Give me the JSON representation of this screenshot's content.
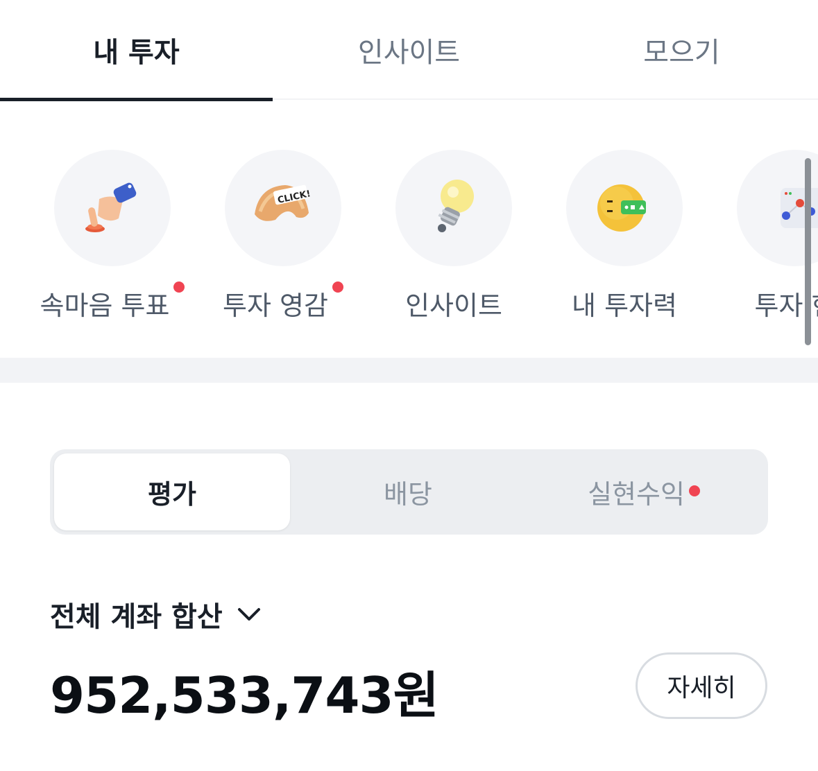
{
  "tabs": [
    {
      "label": "내 투자",
      "active": true
    },
    {
      "label": "인사이트",
      "active": false
    },
    {
      "label": "모으기",
      "active": false
    }
  ],
  "shortcuts": [
    {
      "label": "속마음 투표",
      "icon": "pointing-hand-button-icon",
      "new": true
    },
    {
      "label": "투자 영감",
      "icon": "fortune-cookie-click-icon",
      "badge_text": "CLICK!",
      "new": true
    },
    {
      "label": "인사이트",
      "icon": "lightbulb-icon",
      "new": false
    },
    {
      "label": "내 투자력",
      "icon": "smiley-face-icon",
      "new": false
    },
    {
      "label": "투자 현",
      "icon": "chart-board-icon",
      "new": false
    }
  ],
  "segments": [
    {
      "label": "평가",
      "active": true
    },
    {
      "label": "배당",
      "active": false
    },
    {
      "label": "실현수익",
      "active": false,
      "new": true
    }
  ],
  "account": {
    "selector_label": "전체 계좌 합산",
    "amount": "952,533,743원",
    "detail_button": "자세히"
  },
  "colors": {
    "text_primary": "#191f28",
    "text_secondary": "#6b7684",
    "badge_red": "#f04452",
    "segment_bg": "#eceef1"
  }
}
